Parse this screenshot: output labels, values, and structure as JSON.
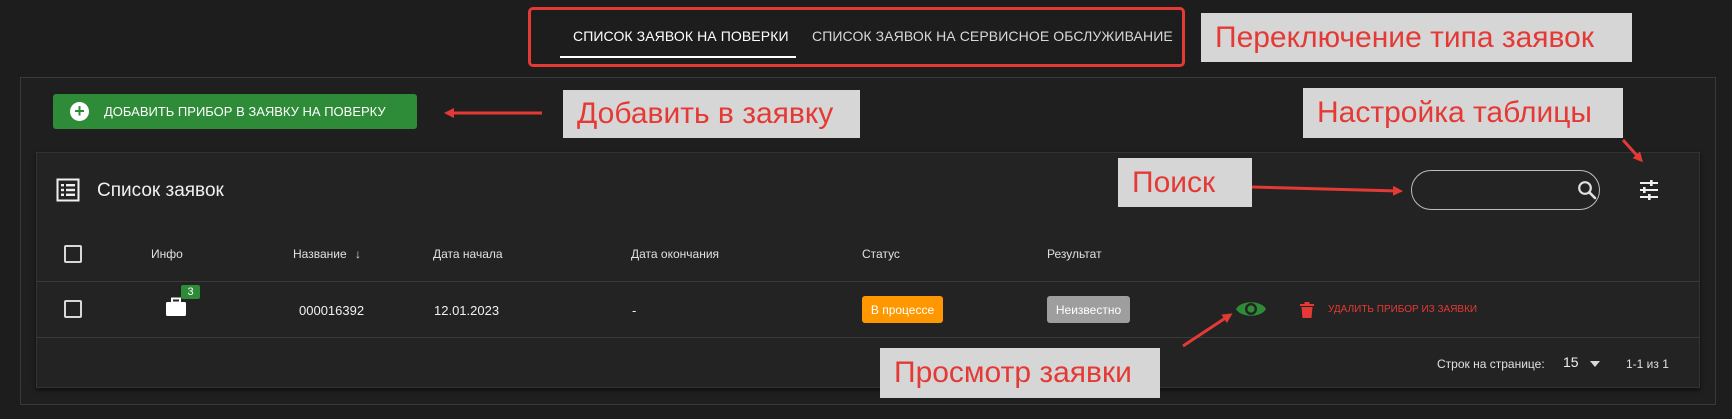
{
  "tabs": [
    {
      "label": "Список заявок на поверки",
      "active": true
    },
    {
      "label": "Список заявок на сервисное обслуживание",
      "active": false
    }
  ],
  "callouts": {
    "switch_type": "Переключение типа заявок",
    "add_to_request": "Добавить в заявку",
    "table_settings": "Настройка таблицы",
    "search": "Поиск",
    "view_request": "Просмотр заявки"
  },
  "toolbar": {
    "add_button_label": "Добавить прибор в заявку на поверку"
  },
  "card": {
    "title": "Список заявок",
    "search_placeholder": ""
  },
  "table": {
    "columns": [
      "Инфо",
      "Название",
      "Дата начала",
      "Дата окончания",
      "Статус",
      "Результат"
    ],
    "sort_indicator": "↓",
    "rows": [
      {
        "info_count": "3",
        "name": "000016392",
        "start_date": "12.01.2023",
        "end_date": "-",
        "status": "В процессе",
        "result": "Неизвестно",
        "delete_label": "Удалить прибор из заявки"
      }
    ]
  },
  "pagination": {
    "rows_per_page_label": "Строк на странице:",
    "rows_per_page": "15",
    "range": "1-1 из 1"
  },
  "colors": {
    "accent_green": "#2e8b37",
    "annotation_red": "#e53935",
    "status_orange": "#ff9800",
    "result_grey": "#9e9e9e"
  }
}
